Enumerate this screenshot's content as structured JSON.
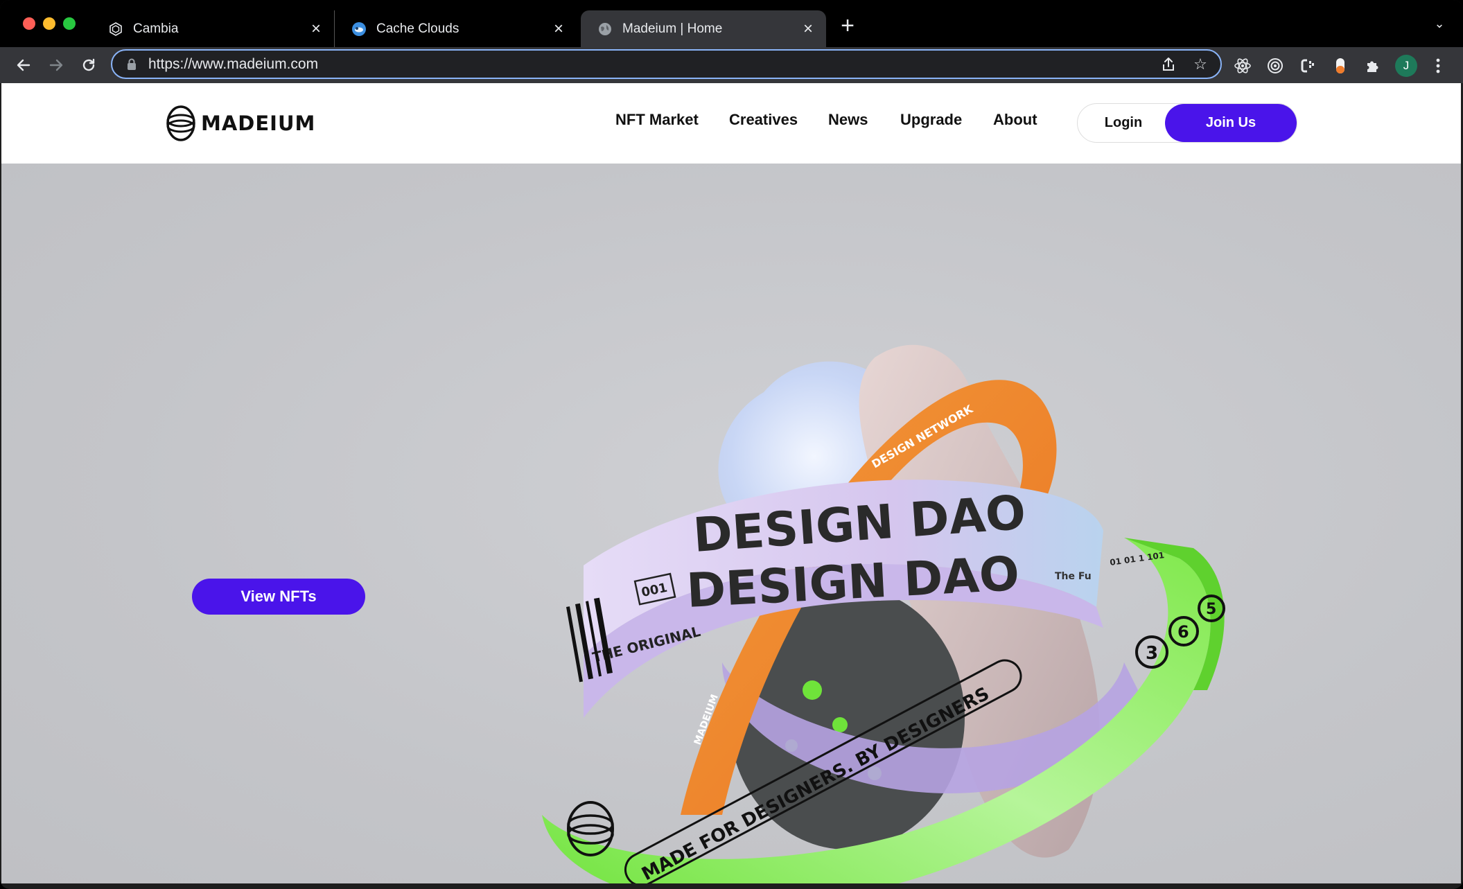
{
  "browser": {
    "tabs": [
      {
        "title": "Cambia",
        "favicon": "cambia-icon",
        "active": false
      },
      {
        "title": "Cache Clouds",
        "favicon": "cache-clouds-icon",
        "active": false
      },
      {
        "title": "Madeium | Home",
        "favicon": "globe-icon",
        "active": true
      }
    ],
    "new_tab_label": "+",
    "url": "https://www.madeium.com",
    "profile_initial": "J"
  },
  "site": {
    "logo_text": "MADEIUM",
    "nav": [
      "NFT Market",
      "Creatives",
      "News",
      "Upgrade",
      "About"
    ],
    "login_label": "Login",
    "join_label": "Join Us",
    "cta_label": "View NFTs"
  },
  "artwork": {
    "band_white_text_1": "DESIGN DAO",
    "band_white_text_2": "DESIGN DAO",
    "band_white_small": "THE ORIGINAL",
    "band_white_code": "001",
    "band_green_text": "MADE FOR DESIGNERS. BY DESIGNERS",
    "band_green_digits": [
      "3",
      "6",
      "5"
    ],
    "band_orange_text": "DESIGN NETWORK",
    "band_orange_brand": "MADEIUM",
    "binary_text": "01 01 1 101",
    "small_label": "The Fu"
  },
  "colors": {
    "accent": "#4a14ea",
    "hero_bg": "#c6c7cb",
    "green_band": "#7fe84a",
    "orange_band": "#f28a2a",
    "lavender_band": "#d9ccf0"
  }
}
